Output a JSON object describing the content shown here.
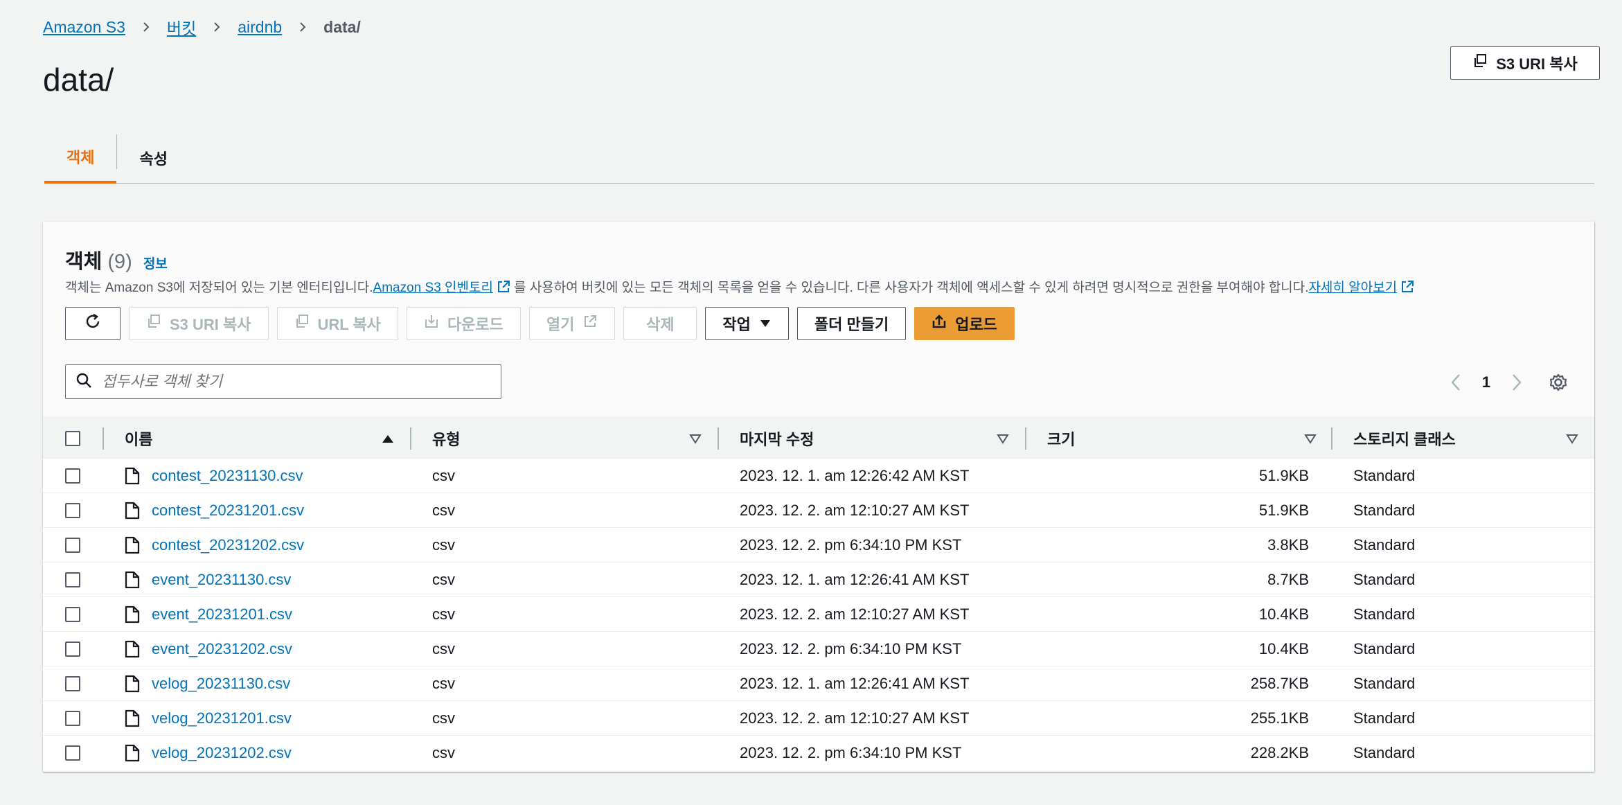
{
  "breadcrumb": {
    "items": [
      "Amazon S3",
      "버킷",
      "airdnb"
    ],
    "current": "data/"
  },
  "page": {
    "title": "data/",
    "copy_uri_label": "S3 URI 복사"
  },
  "tabs": [
    {
      "label": "객체",
      "active": true
    },
    {
      "label": "속성",
      "active": false
    }
  ],
  "panel": {
    "heading": "객체",
    "count": "(9)",
    "info": "정보",
    "desc_pre": "객체는 Amazon S3에 저장되어 있는 기본 엔터티입니다. ",
    "desc_link1": "Amazon S3 인벤토리",
    "desc_mid": "를 사용하여 버킷에 있는 모든 객체의 목록을 얻을 수 있습니다. 다른 사용자가 객체에 액세스할 수 있게 하려면 명시적으로 권한을 부여해야 합니다. ",
    "desc_link2": "자세히 알아보기"
  },
  "actions": {
    "copy_s3_uri": "S3 URI 복사",
    "copy_url": "URL 복사",
    "download": "다운로드",
    "open": "열기",
    "delete": "삭제",
    "actions": "작업",
    "create_folder": "폴더 만들기",
    "upload": "업로드"
  },
  "search": {
    "placeholder": "접두사로 객체 찾기"
  },
  "pagination": {
    "page": "1"
  },
  "table": {
    "headers": {
      "name": "이름",
      "type": "유형",
      "modified": "마지막 수정",
      "size": "크기",
      "storage": "스토리지 클래스"
    },
    "rows": [
      {
        "name": "contest_20231130.csv",
        "type": "csv",
        "modified": "2023. 12. 1. am 12:26:42 AM KST",
        "size": "51.9KB",
        "storage": "Standard"
      },
      {
        "name": "contest_20231201.csv",
        "type": "csv",
        "modified": "2023. 12. 2. am 12:10:27 AM KST",
        "size": "51.9KB",
        "storage": "Standard"
      },
      {
        "name": "contest_20231202.csv",
        "type": "csv",
        "modified": "2023. 12. 2. pm 6:34:10 PM KST",
        "size": "3.8KB",
        "storage": "Standard"
      },
      {
        "name": "event_20231130.csv",
        "type": "csv",
        "modified": "2023. 12. 1. am 12:26:41 AM KST",
        "size": "8.7KB",
        "storage": "Standard"
      },
      {
        "name": "event_20231201.csv",
        "type": "csv",
        "modified": "2023. 12. 2. am 12:10:27 AM KST",
        "size": "10.4KB",
        "storage": "Standard"
      },
      {
        "name": "event_20231202.csv",
        "type": "csv",
        "modified": "2023. 12. 2. pm 6:34:10 PM KST",
        "size": "10.4KB",
        "storage": "Standard"
      },
      {
        "name": "velog_20231130.csv",
        "type": "csv",
        "modified": "2023. 12. 1. am 12:26:41 AM KST",
        "size": "258.7KB",
        "storage": "Standard"
      },
      {
        "name": "velog_20231201.csv",
        "type": "csv",
        "modified": "2023. 12. 2. am 12:10:27 AM KST",
        "size": "255.1KB",
        "storage": "Standard"
      },
      {
        "name": "velog_20231202.csv",
        "type": "csv",
        "modified": "2023. 12. 2. pm 6:34:10 PM KST",
        "size": "228.2KB",
        "storage": "Standard"
      }
    ]
  },
  "colors": {
    "link": "#0073bb",
    "accent": "#ec7211",
    "primary_button": "#ec9c34"
  }
}
